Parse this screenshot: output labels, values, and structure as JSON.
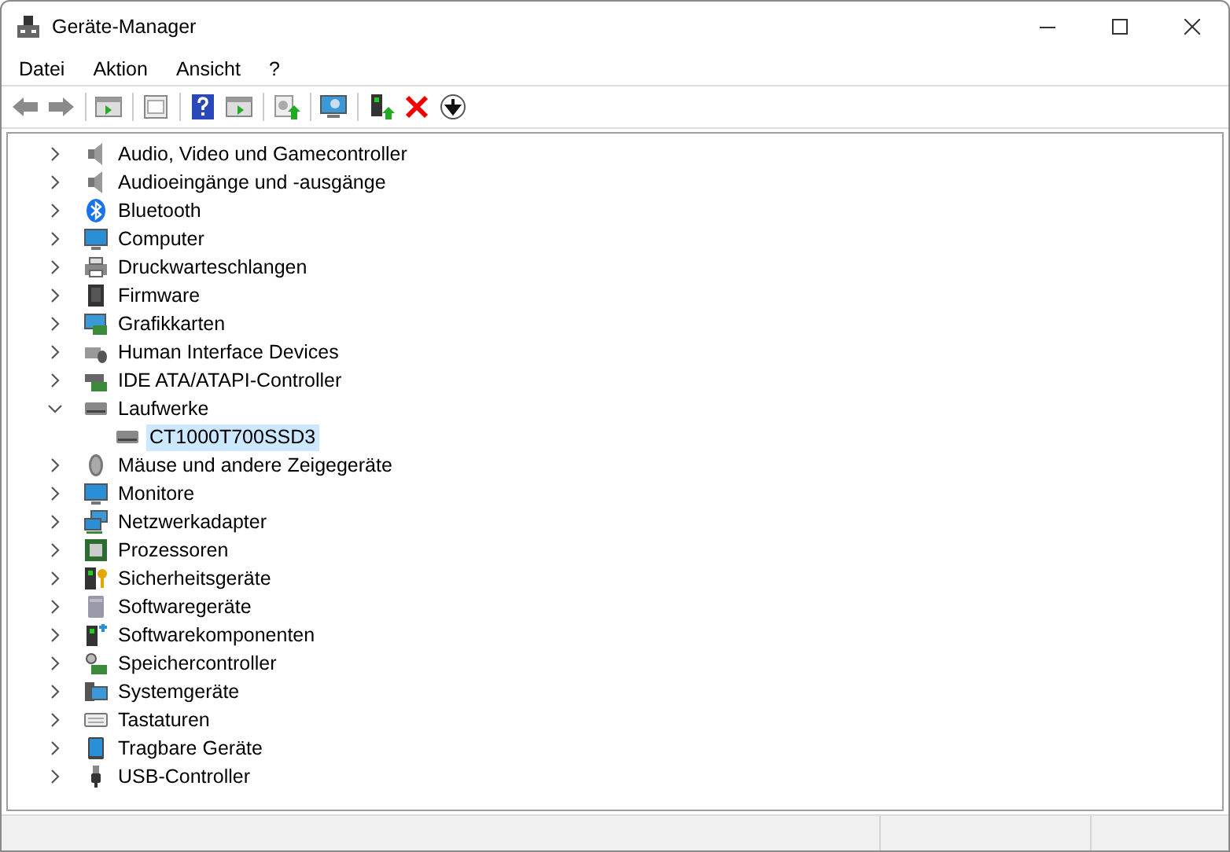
{
  "window": {
    "title": "Geräte-Manager"
  },
  "menu": [
    "Datei",
    "Aktion",
    "Ansicht",
    "?"
  ],
  "tree": [
    {
      "label": "Audio, Video und Gamecontroller",
      "expanded": false
    },
    {
      "label": "Audioeingänge und -ausgänge",
      "expanded": false
    },
    {
      "label": "Bluetooth",
      "expanded": false
    },
    {
      "label": "Computer",
      "expanded": false
    },
    {
      "label": "Druckwarteschlangen",
      "expanded": false
    },
    {
      "label": "Firmware",
      "expanded": false
    },
    {
      "label": "Grafikkarten",
      "expanded": false
    },
    {
      "label": "Human Interface Devices",
      "expanded": false
    },
    {
      "label": "IDE ATA/ATAPI-Controller",
      "expanded": false
    },
    {
      "label": "Laufwerke",
      "expanded": true,
      "children": [
        {
          "label": "CT1000T700SSD3",
          "selected": true
        }
      ]
    },
    {
      "label": "Mäuse und andere Zeigegeräte",
      "expanded": false
    },
    {
      "label": "Monitore",
      "expanded": false
    },
    {
      "label": "Netzwerkadapter",
      "expanded": false
    },
    {
      "label": "Prozessoren",
      "expanded": false
    },
    {
      "label": "Sicherheitsgeräte",
      "expanded": false
    },
    {
      "label": "Softwaregeräte",
      "expanded": false
    },
    {
      "label": "Softwarekomponenten",
      "expanded": false
    },
    {
      "label": "Speichercontroller",
      "expanded": false
    },
    {
      "label": "Systemgeräte",
      "expanded": false
    },
    {
      "label": "Tastaturen",
      "expanded": false
    },
    {
      "label": "Tragbare Geräte",
      "expanded": false
    },
    {
      "label": "USB-Controller",
      "expanded": false
    }
  ]
}
